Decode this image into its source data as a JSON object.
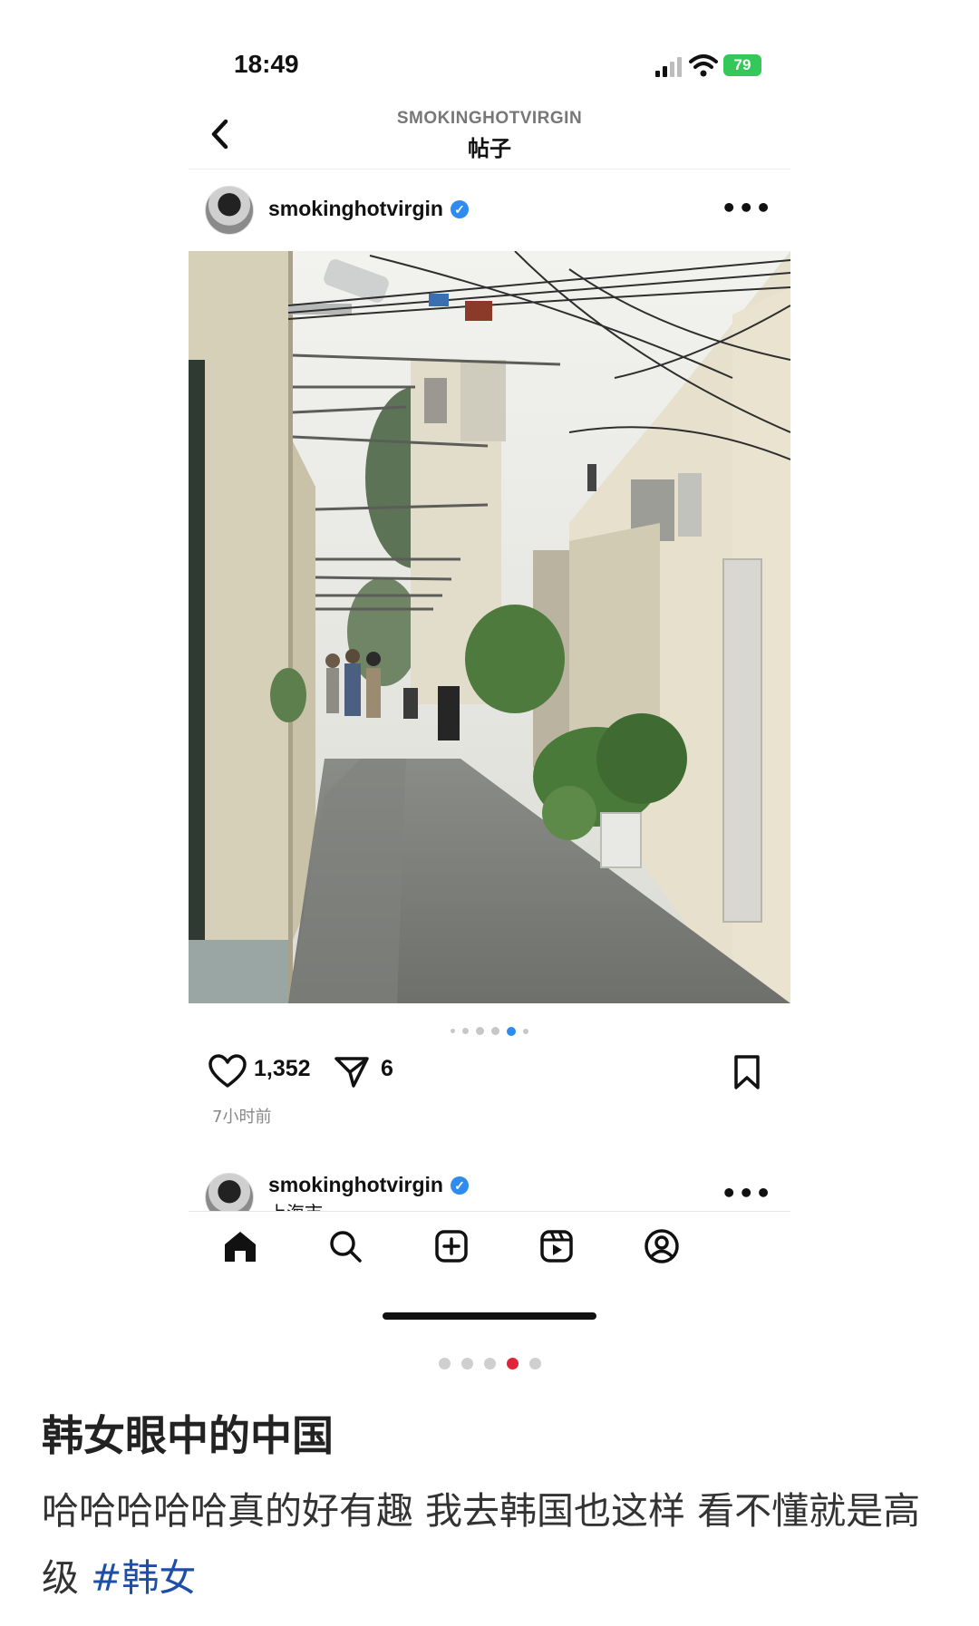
{
  "status_bar": {
    "time": "18:49",
    "battery": "79"
  },
  "header": {
    "account": "SMOKINGHOTVIRGIN",
    "title": "帖子"
  },
  "post": {
    "username": "smokinghotvirgin",
    "verified_mark": "✓",
    "more": "•••",
    "likes": "1,352",
    "shares": "6",
    "time_ago": "7小时前",
    "photo_page": 5,
    "photo_count": 6
  },
  "next_post": {
    "username": "smokinghotvirgin",
    "verified_mark": "✓",
    "location": "上海市",
    "more": "•••"
  },
  "tab_bar": {
    "items": [
      {
        "name": "home-icon",
        "active": true
      },
      {
        "name": "search-icon",
        "active": false
      },
      {
        "name": "create-icon",
        "active": false
      },
      {
        "name": "reels-icon",
        "active": false
      },
      {
        "name": "profile-icon",
        "active": false
      }
    ]
  },
  "gallery": {
    "current": 4,
    "total": 5
  },
  "caption": {
    "title": "韩女眼中的中国",
    "body": "哈哈哈哈哈真的好有趣 我去韩国也这样 看不懂就是高级 ",
    "hashtag": "#韩女"
  },
  "colors": {
    "verified": "#2e8bf0",
    "battery": "#34c759",
    "active_dot": "#e0243c",
    "hashtag": "#1d4ea8",
    "carousel_active": "#2e8bf0"
  }
}
